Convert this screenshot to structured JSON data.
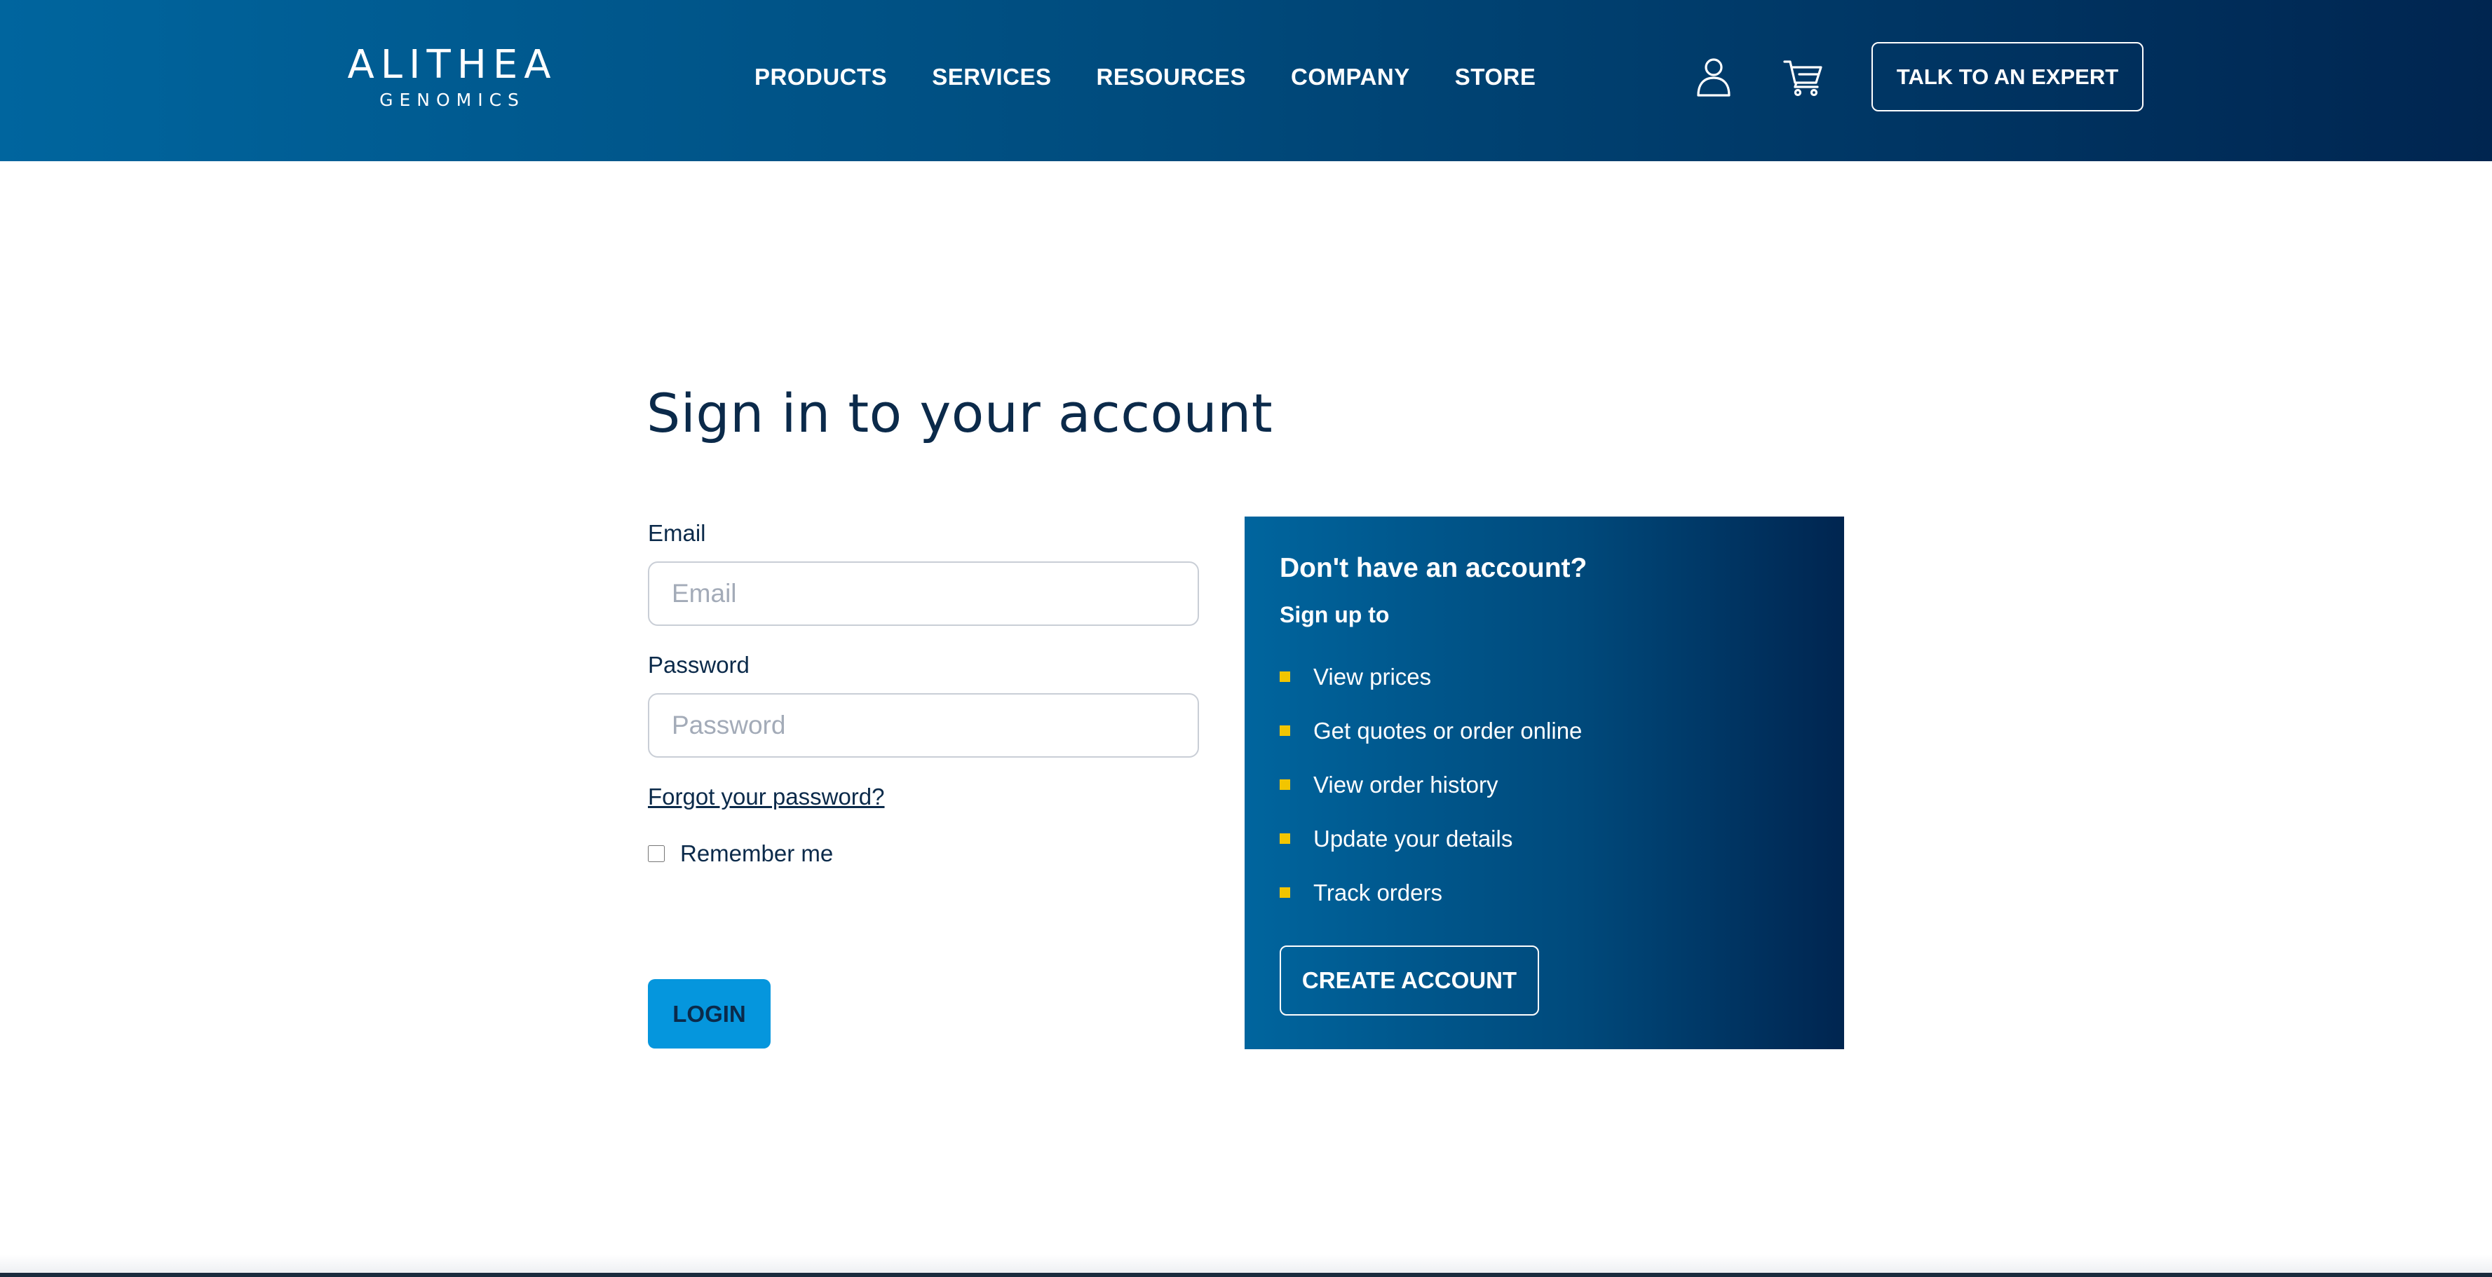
{
  "header": {
    "logo": {
      "main": "ALITHEA",
      "sub": "GENOMICS"
    },
    "nav": [
      {
        "label": "PRODUCTS"
      },
      {
        "label": "SERVICES"
      },
      {
        "label": "RESOURCES"
      },
      {
        "label": "COMPANY"
      },
      {
        "label": "STORE"
      }
    ],
    "icons": {
      "account": "user-icon",
      "cart": "cart-icon"
    },
    "cta_label": "TALK TO AN EXPERT"
  },
  "login": {
    "title": "Sign in to your account",
    "email_label": "Email",
    "email_placeholder": "Email",
    "email_value": "",
    "password_label": "Password",
    "password_placeholder": "Password",
    "password_value": "",
    "forgot_label": "Forgot your password?",
    "remember_label": "Remember me",
    "remember_checked": false,
    "submit_label": "LOGIN"
  },
  "signup": {
    "title": "Don't have an account?",
    "subtitle": "Sign up to",
    "benefits": [
      "View prices",
      "Get quotes or order online",
      "View order history",
      "Update your details",
      "Track orders"
    ],
    "button_label": "CREATE ACCOUNT"
  },
  "colors": {
    "brand_dark": "#002550",
    "brand_mid": "#00659e",
    "accent_button": "#0596dd",
    "bullet": "#f2c500",
    "text_dark": "#0b2a4a"
  }
}
